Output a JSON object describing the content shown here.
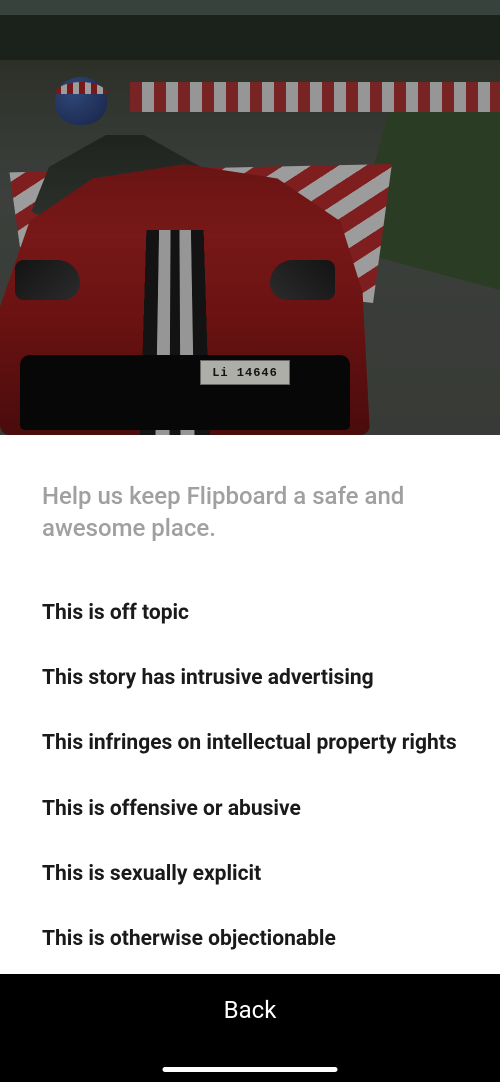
{
  "image": {
    "license_plate": "Li 14646"
  },
  "header": {
    "subheading": "Help us keep Flipboard a safe and awesome place."
  },
  "report_options": [
    "This is off topic",
    "This story has intrusive advertising",
    "This infringes on intellectual property rights",
    "This is offensive or abusive",
    "This is sexually explicit",
    "This is otherwise objectionable"
  ],
  "footer": {
    "back_label": "Back"
  }
}
